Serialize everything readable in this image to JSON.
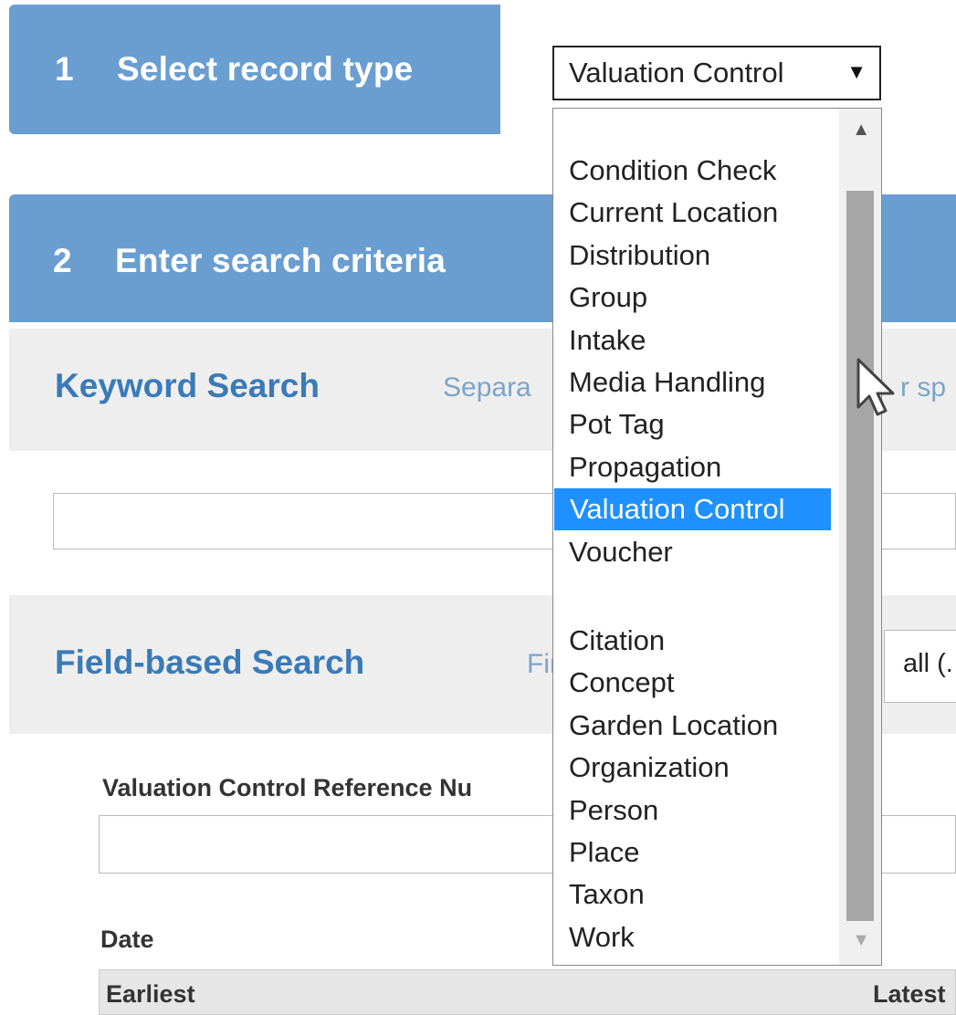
{
  "step1": {
    "number": "1",
    "title": "Select record type"
  },
  "record_type_select": {
    "selected_value": "Valuation Control"
  },
  "step2": {
    "number": "2",
    "title": "Enter search criteria"
  },
  "keyword_search": {
    "title": "Keyword Search",
    "hint_visible_start": "Separa",
    "hint_visible_end": "r sp"
  },
  "field_based_search": {
    "title": "Field-based Search",
    "hint_visible_start": "Fin",
    "match_select_value": "all (."
  },
  "fields": {
    "valuation_control_reference_number_label": "Valuation Control Reference Nu",
    "date_label": "Date",
    "date_earliest_header": "Earliest",
    "date_latest_header": "Latest"
  },
  "dropdown": {
    "group1": [
      "Condition Check",
      "Current Location",
      "Distribution",
      "Group",
      "Intake",
      "Media Handling",
      "Pot Tag",
      "Propagation",
      "Valuation Control",
      "Voucher"
    ],
    "group2": [
      "Citation",
      "Concept",
      "Garden Location",
      "Organization",
      "Person",
      "Place",
      "Taxon",
      "Work"
    ],
    "selected": "Valuation Control"
  },
  "colors": {
    "header_blue": "#6a9ed1",
    "title_blue": "#3a7ab8",
    "selection_blue": "#1e90ff"
  }
}
